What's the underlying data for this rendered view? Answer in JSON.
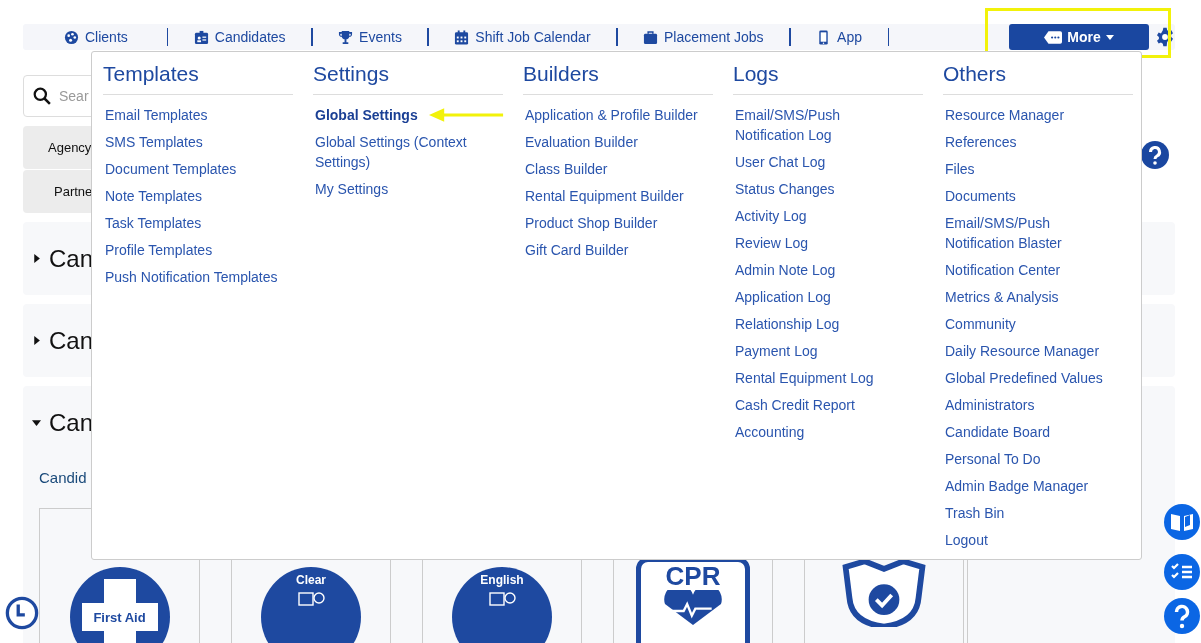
{
  "nav": {
    "items": [
      {
        "label": "Clients",
        "kind": "palette"
      },
      {
        "label": "Candidates",
        "kind": "badge"
      },
      {
        "label": "Events",
        "kind": "trophy"
      },
      {
        "label": "Shift Job Calendar",
        "kind": "calendar"
      },
      {
        "label": "Placement Jobs",
        "kind": "briefcase"
      },
      {
        "label": "App",
        "kind": "phone"
      }
    ],
    "more_button": {
      "label": "More",
      "highlighted": true
    }
  },
  "background": {
    "search": {
      "placeholder": "Sear"
    },
    "tabs": [
      "Agency",
      "Partne"
    ],
    "sections": [
      {
        "title": "Can",
        "expanded": false
      },
      {
        "title": "Can",
        "expanded": false
      },
      {
        "title": "Can",
        "expanded": true,
        "subtitle": "Candid",
        "badges": [
          {
            "label": "First Aid",
            "kind": "cross"
          },
          {
            "label": "Clear",
            "kind": "circle"
          },
          {
            "label": "English",
            "kind": "circle"
          },
          {
            "label": "CPR",
            "kind": "square"
          },
          {
            "kind": "shield"
          }
        ]
      }
    ]
  },
  "menu": {
    "columns": [
      {
        "title": "Templates",
        "items": [
          {
            "label": "Email Templates",
            "highlighted": false
          },
          {
            "label": "SMS Templates",
            "highlighted": false
          },
          {
            "label": "Document Templates",
            "highlighted": false
          },
          {
            "label": "Note Templates",
            "highlighted": false
          },
          {
            "label": "Task Templates",
            "highlighted": false
          },
          {
            "label": "Profile Templates",
            "highlighted": false
          },
          {
            "label": "Push Notification Templates",
            "highlighted": false
          }
        ]
      },
      {
        "title": "Settings",
        "items": [
          {
            "label": "Global Settings",
            "highlighted": true
          },
          {
            "label": "Global Settings (Context Settings)",
            "highlighted": false
          },
          {
            "label": "My Settings",
            "highlighted": false
          }
        ]
      },
      {
        "title": "Builders",
        "items": [
          {
            "label": "Application & Profile Builder",
            "highlighted": false
          },
          {
            "label": "Evaluation Builder",
            "highlighted": false
          },
          {
            "label": "Class Builder",
            "highlighted": false
          },
          {
            "label": "Rental Equipment Builder",
            "highlighted": false
          },
          {
            "label": "Product Shop Builder",
            "highlighted": false
          },
          {
            "label": "Gift Card Builder",
            "highlighted": false
          }
        ]
      },
      {
        "title": "Logs",
        "items": [
          {
            "label": "Email/SMS/Push Notification Log",
            "highlighted": false
          },
          {
            "label": "User Chat Log",
            "highlighted": false
          },
          {
            "label": "Status Changes",
            "highlighted": false
          },
          {
            "label": "Activity Log",
            "highlighted": false
          },
          {
            "label": "Review Log",
            "highlighted": false
          },
          {
            "label": "Admin Note Log",
            "highlighted": false
          },
          {
            "label": "Application Log",
            "highlighted": false
          },
          {
            "label": "Relationship Log",
            "highlighted": false
          },
          {
            "label": "Payment Log",
            "highlighted": false
          },
          {
            "label": "Rental Equipment Log",
            "highlighted": false
          },
          {
            "label": "Cash Credit Report",
            "highlighted": false
          },
          {
            "label": "Accounting",
            "highlighted": false
          }
        ]
      },
      {
        "title": "Others",
        "items": [
          {
            "label": "Resource Manager",
            "highlighted": false
          },
          {
            "label": "References",
            "highlighted": false
          },
          {
            "label": "Files",
            "highlighted": false
          },
          {
            "label": "Documents",
            "highlighted": false
          },
          {
            "label": "Email/SMS/Push Notification Blaster",
            "highlighted": false
          },
          {
            "label": "Notification Center",
            "highlighted": false
          },
          {
            "label": "Metrics & Analysis",
            "highlighted": false
          },
          {
            "label": "Community",
            "highlighted": false
          },
          {
            "label": "Daily Resource Manager",
            "highlighted": false
          },
          {
            "label": "Global Predefined Values",
            "highlighted": false
          },
          {
            "label": "Administrators",
            "highlighted": false
          },
          {
            "label": "Candidate Board",
            "highlighted": false
          },
          {
            "label": "Personal To Do",
            "highlighted": false
          },
          {
            "label": "Admin Badge Manager",
            "highlighted": false
          },
          {
            "label": "Trash Bin",
            "highlighted": false
          },
          {
            "label": "Logout",
            "highlighted": false
          }
        ]
      }
    ]
  }
}
